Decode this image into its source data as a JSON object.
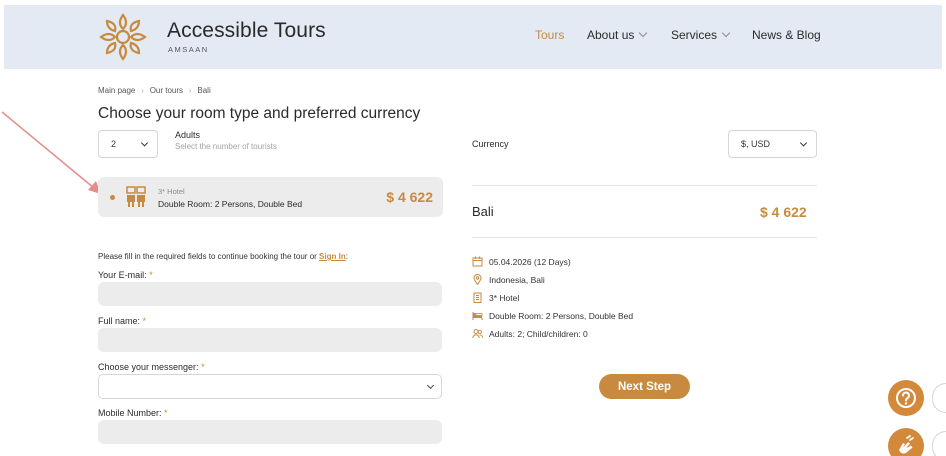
{
  "brand": {
    "title": "Accessible Tours",
    "subtitle": "AMSAAN",
    "color": "#c88a3e"
  },
  "nav": {
    "tours": "Tours",
    "about": "About us",
    "services": "Services",
    "news": "News & Blog"
  },
  "breadcrumb": [
    "Main page",
    "Our tours",
    "Bali"
  ],
  "page": {
    "title": "Choose your room type and preferred currency"
  },
  "adults": {
    "selected": "2",
    "label": "Adults",
    "hint": "Select the number of tourists"
  },
  "room": {
    "category": "3* Hotel",
    "type": "Double Room: 2 Persons, Double Bed",
    "price": "$ 4 622"
  },
  "form": {
    "intro": "Please fill in the required fields to continue booking the tour or",
    "sign_in": "Sign In",
    "intro_end": ":",
    "required_mark": "*",
    "email_label": "Your E-mail:",
    "name_label": "Full name:",
    "messenger_label": "Choose your messenger:",
    "phone_label": "Mobile Number:"
  },
  "summary": {
    "currency_label": "Currency",
    "currency_value": "$, USD",
    "tour_name": "Bali",
    "tour_price": "$ 4 622",
    "details": {
      "dates": "05.04.2026 (12 Days)",
      "location": "Indonesia, Bali",
      "hotel": "3* Hotel",
      "room": "Double Room: 2 Persons, Double Bed",
      "guests": "Adults: 2; Child/children: 0"
    },
    "next_button": "Next Step"
  },
  "icons": {
    "help": "help-icon",
    "sign_language": "sign-language-icon"
  }
}
